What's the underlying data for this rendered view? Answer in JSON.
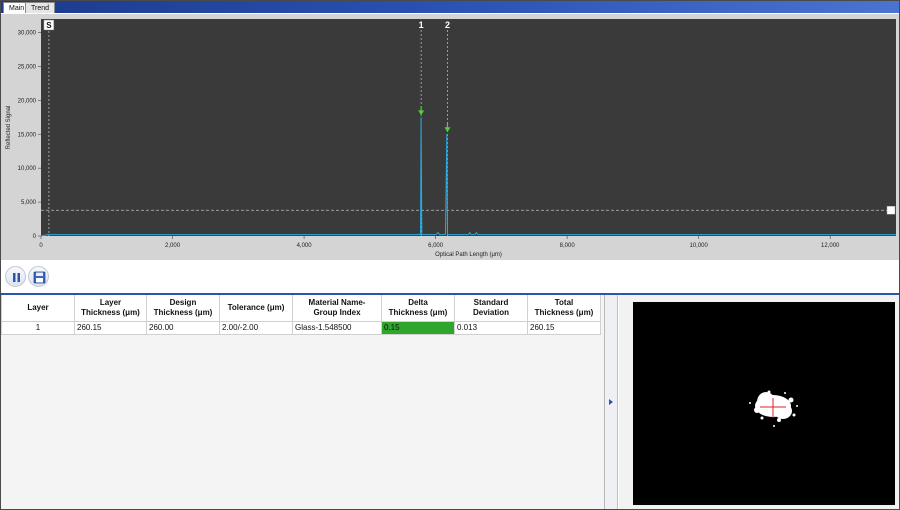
{
  "tabs": [
    {
      "label": "Main"
    },
    {
      "label": "Trend"
    }
  ],
  "chart_data": {
    "type": "line",
    "xlabel": "Optical Path Length (μm)",
    "ylabel": "Reflected Signal",
    "xlim": [
      0,
      13000
    ],
    "ylim": [
      0,
      32000
    ],
    "xticks": [
      0,
      2000,
      4000,
      6000,
      8000,
      10000,
      12000
    ],
    "xtick_labels": [
      "0",
      "2,000",
      "4,000",
      "6,000",
      "8,000",
      "10,000",
      "12,000"
    ],
    "yticks": [
      0,
      5000,
      10000,
      15000,
      20000,
      25000,
      30000
    ],
    "ytick_labels": [
      "0",
      "5,000",
      "10,000",
      "15,000",
      "20,000",
      "25,000",
      "30,000"
    ],
    "series": [
      {
        "x": [
          0,
          100,
          5700,
          5770,
          5780,
          5790,
          5860,
          6000,
          6040,
          6060,
          6080,
          6120,
          6150,
          6170,
          6180,
          6190,
          6260,
          6500,
          6520,
          6540,
          6600,
          6620,
          6640,
          13000
        ],
        "values": [
          0,
          200,
          200,
          250,
          17500,
          250,
          200,
          200,
          500,
          200,
          200,
          200,
          250,
          15000,
          250,
          200,
          200,
          200,
          500,
          200,
          200,
          500,
          200,
          200
        ]
      }
    ],
    "threshold": 3800,
    "start_marker": {
      "label": "S",
      "x": 120
    },
    "peak_markers": [
      {
        "label": "1",
        "x": 5780,
        "y": 17500
      },
      {
        "label": "2",
        "x": 6180,
        "y": 15000
      }
    ],
    "grid": false,
    "colors": {
      "line": "#29a8e0",
      "plot_bg": "#3a3a3a",
      "chart_bg": "#d4d4d4",
      "peak_arrow": "#4cd137",
      "marker_line": "#c8c8c8"
    }
  },
  "toolbar": {
    "pause_icon": "pause-icon",
    "save_icon": "save-icon"
  },
  "table": {
    "headers": [
      "Layer",
      "Layer\nThickness (μm)",
      "Design\nThickness (μm)",
      "Tolerance (μm)",
      "Material Name-\nGroup Index",
      "Delta\nThickness (μm)",
      "Standard\nDeviation",
      "Total\nThickness (μm)"
    ],
    "rows": [
      [
        "1",
        "260.15",
        "260.00",
        "2.00/-2.00",
        "Glass-1.548500",
        "0.15",
        "0.013",
        "260.15"
      ]
    ],
    "delta_color": "#2fa52b"
  },
  "camera": {
    "crosshair_color": "#e02020"
  }
}
